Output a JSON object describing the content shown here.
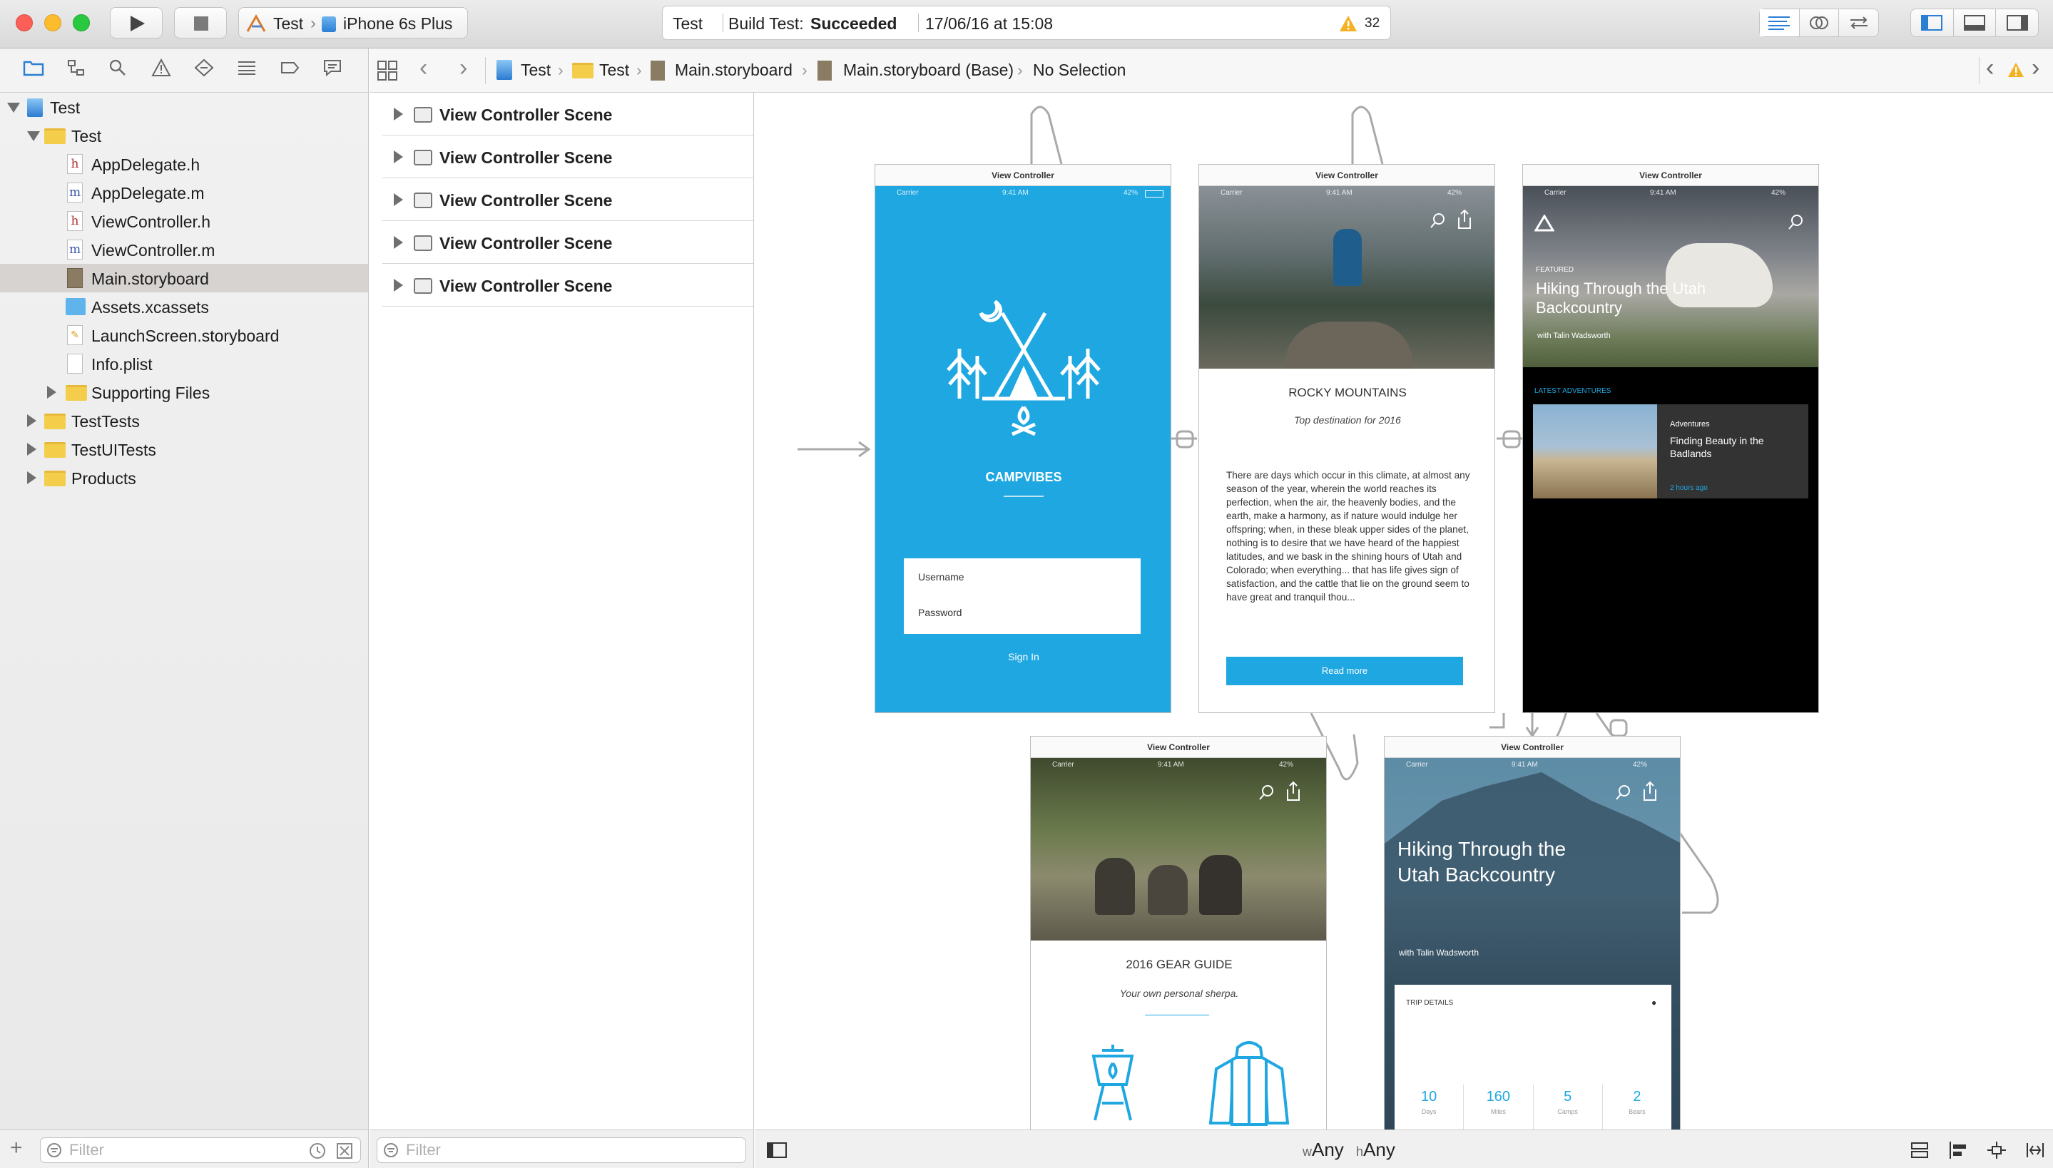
{
  "toolbar": {
    "scheme": "Test",
    "device": "iPhone 6s Plus",
    "activity": {
      "project": "Test",
      "status_prefix": "Build Test:",
      "status": "Succeeded",
      "datetime": "17/06/16 at 15:08",
      "warnings": "32"
    }
  },
  "tree": [
    {
      "label": "Test"
    },
    {
      "label": "Test"
    },
    {
      "label": "AppDelegate.h",
      "glyph": "h"
    },
    {
      "label": "AppDelegate.m",
      "glyph": "m"
    },
    {
      "label": "ViewController.h",
      "glyph": "h"
    },
    {
      "label": "ViewController.m",
      "glyph": "m"
    },
    {
      "label": "Main.storyboard"
    },
    {
      "label": "Assets.xcassets"
    },
    {
      "label": "LaunchScreen.storyboard"
    },
    {
      "label": "Info.plist"
    },
    {
      "label": "Supporting Files"
    },
    {
      "label": "TestTests"
    },
    {
      "label": "TestUITests"
    },
    {
      "label": "Products"
    }
  ],
  "filter_placeholder": "Filter",
  "jumpbar": {
    "items": [
      "Test",
      "Test",
      "Main.storyboard",
      "Main.storyboard (Base)",
      "No Selection"
    ]
  },
  "outline": [
    "View Controller Scene",
    "View Controller Scene",
    "View Controller Scene",
    "View Controller Scene",
    "View Controller Scene"
  ],
  "canvas": {
    "vc_title": "View Controller",
    "status": {
      "carrier": "Carrier",
      "time": "9:41 AM",
      "battery": "42%"
    },
    "login": {
      "app_name": "CAMPVIBES",
      "username_placeholder": "Username",
      "password_placeholder": "Password",
      "signin": "Sign In"
    },
    "article": {
      "title": "ROCKY MOUNTAINS",
      "subtitle": "Top destination for 2016",
      "body": "There are days which occur in this climate, at almost any season of the year, wherein the world reaches its perfection, when the air, the heavenly bodies, and the earth, make a harmony, as if nature would indulge her offspring; when, in these bleak upper sides of the planet, nothing is to desire that we have heard of the happiest latitudes, and we bask in the shining hours of Utah and Colorado; when everything... that has life gives sign of satisfaction, and the cattle that lie on the ground seem to have great and tranquil thou...",
      "button": "Read more"
    },
    "featured": {
      "tag": "FEATURED",
      "title": "Hiking Through the Utah Backcountry",
      "author": "with Talin Wadsworth",
      "section": "LATEST ADVENTURES",
      "card_tag": "Adventures",
      "card_title": "Finding Beauty in the Badlands",
      "card_time": "2 hours ago"
    },
    "gear": {
      "title": "2016 GEAR GUIDE",
      "subtitle": "Your own personal sherpa."
    },
    "trip": {
      "title": "Hiking Through the Utah Backcountry",
      "author": "with Talin Wadsworth",
      "details_label": "TRIP DETAILS",
      "stats": [
        {
          "value": "10",
          "label": "Days"
        },
        {
          "value": "160",
          "label": "Miles"
        },
        {
          "value": "5",
          "label": "Camps"
        },
        {
          "value": "2",
          "label": "Bears"
        }
      ]
    }
  },
  "size_classes": {
    "w_prefix": "w",
    "w": "Any",
    "h_prefix": "h",
    "h": "Any"
  },
  "colors": {
    "accent": "#1ea7e1",
    "selection": "#d6d3d1"
  }
}
